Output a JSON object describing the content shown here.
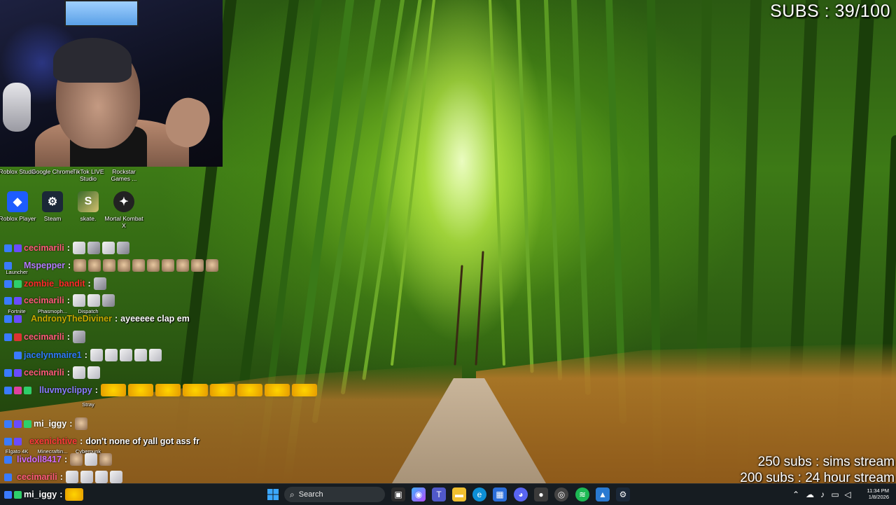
{
  "overlay": {
    "subs_counter": "SUBS : 39/100",
    "goals": [
      "250 subs : sims stream",
      "200 subs : 24 hour stream"
    ]
  },
  "desktop_icons": {
    "top_row": [
      "Roblox Studio",
      "Google Chrome",
      "TikTok LIVE Studio",
      "Rockstar Games ..."
    ],
    "second_row": [
      "Roblox Player",
      "Steam",
      "skate.",
      "Mortal Kombat X"
    ],
    "left_column": [
      "Launcher",
      "Fortnite",
      "Phasmoph...",
      "Dispatch",
      "Stray",
      "Elgato 4K",
      "Minecraftin...",
      "Cyberpunk"
    ]
  },
  "chat": [
    {
      "user": "cecimarili",
      "color": "#ff5a7a",
      "text": ""
    },
    {
      "user": "Mspepper",
      "color": "#b47bff",
      "text": ""
    },
    {
      "user": "zombie_bandit",
      "color": "#ff2a2a",
      "text": ""
    },
    {
      "user": "cecimarili",
      "color": "#ff5a7a",
      "text": ""
    },
    {
      "user": "AndronyTheDiviner",
      "color": "#c6a800",
      "text": "ayeeeee clap em"
    },
    {
      "user": "cecimarili",
      "color": "#ff5a7a",
      "text": ""
    },
    {
      "user": "jacelynmaire1",
      "color": "#2f7bff",
      "text": ""
    },
    {
      "user": "cecimarili",
      "color": "#ff5a7a",
      "text": ""
    },
    {
      "user": "lluvmyclippy",
      "color": "#8a7bff",
      "text": ""
    },
    {
      "user": "mi_iggy",
      "color": "#ffffff",
      "text": ""
    },
    {
      "user": "exenichtive",
      "color": "#ff3a3a",
      "text": "don't none of yall got ass fr"
    },
    {
      "user": "livdoll8417",
      "color": "#d06cff",
      "text": ""
    },
    {
      "user": "cecimarili",
      "color": "#ff5a7a",
      "text": ""
    },
    {
      "user": "mi_iggy",
      "color": "#ffffff",
      "text": ""
    }
  ],
  "taskbar": {
    "search_placeholder": "Search",
    "time": "11:34 PM",
    "date": "1/8/2026"
  }
}
